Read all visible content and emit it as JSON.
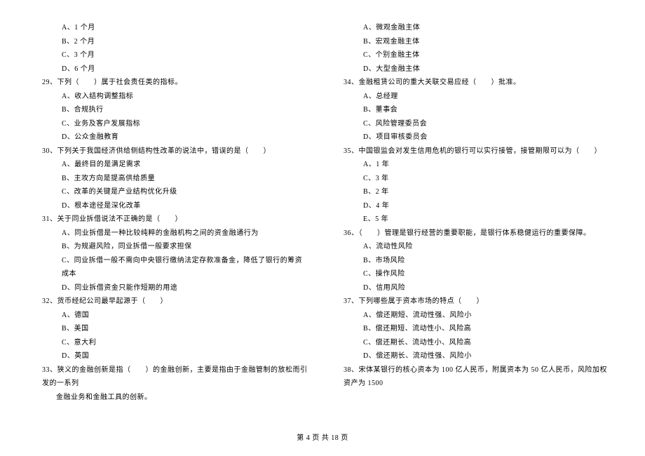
{
  "left_column": {
    "q28_options": [
      "A、1 个月",
      "B、2 个月",
      "C、3 个月",
      "D、6 个月"
    ],
    "q29": {
      "stem": "29、下列（　　）属于社会责任类的指标。",
      "options": [
        "A、收入结构调整指标",
        "B、合规执行",
        "C、业务及客户发展指标",
        "D、公众金融教育"
      ]
    },
    "q30": {
      "stem": "30、下列关于我国经济供给侧结构性改革的说法中，错误的是（　　）",
      "options": [
        "A、最终目的是满足需求",
        "B、主攻方向是提高供给质量",
        "C、改革的关键是产业结构优化升级",
        "D、根本途径是深化改革"
      ]
    },
    "q31": {
      "stem": "31、关于同业拆借说法不正确的是（　　）",
      "options": [
        "A、同业拆借是一种比较纯粹的金融机构之间的资金融通行为",
        "B、为规避风险，同业拆借一般要求担保",
        "C、同业拆借一般不需向中央银行缴纳法定存款准备金，降低了银行的筹资成本",
        "D、同业拆借资金只能作短期的用途"
      ]
    },
    "q32": {
      "stem": "32、货币经纪公司最早起源于（　　）",
      "options": [
        "A、德国",
        "B、美国",
        "C、意大利",
        "D、英国"
      ]
    },
    "q33": {
      "stem_line1": "33、狭义的金融创新是指（　　）的金融创新，主要是指由于金融管制的放松而引发的一系列",
      "stem_line2": "金融业务和金融工具的创新。"
    }
  },
  "right_column": {
    "q33_options": [
      "A、微观金融主体",
      "B、宏观金融主体",
      "C、个别金融主体",
      "D、大型金融主体"
    ],
    "q34": {
      "stem": "34、金融租赁公司的重大关联交易应经（　　）批准。",
      "options": [
        "A、总经理",
        "B、董事会",
        "C、风险管理委员会",
        "D、项目审核委员会"
      ]
    },
    "q35": {
      "stem": "35、中国银监会对发生信用危机的银行可以实行接管，接管期限可以为（　　）",
      "options": [
        "A、1 年",
        "C、3 年",
        "B、2 年",
        "D、4 年",
        "E、5 年"
      ]
    },
    "q36": {
      "stem": "36、（　　）管理是银行经营的重要职能，是银行体系稳健运行的重要保障。",
      "options": [
        "A、流动性风险",
        "B、市场风险",
        "C、操作风险",
        "D、信用风险"
      ]
    },
    "q37": {
      "stem": "37、下列哪些属于资本市场的特点（　　）",
      "options": [
        "A、偿还期短、流动性强、风险小",
        "B、偿还期短、流动性小、风险高",
        "C、偿还期长、流动性小、风险高",
        "D、偿还期长、流动性强、风险小"
      ]
    },
    "q38": {
      "stem": "38、宋体某银行的核心资本为 100 亿人民币，附属资本为 50 亿人民币，风险加权资产为 1500"
    }
  },
  "footer": "第 4 页 共 18 页"
}
